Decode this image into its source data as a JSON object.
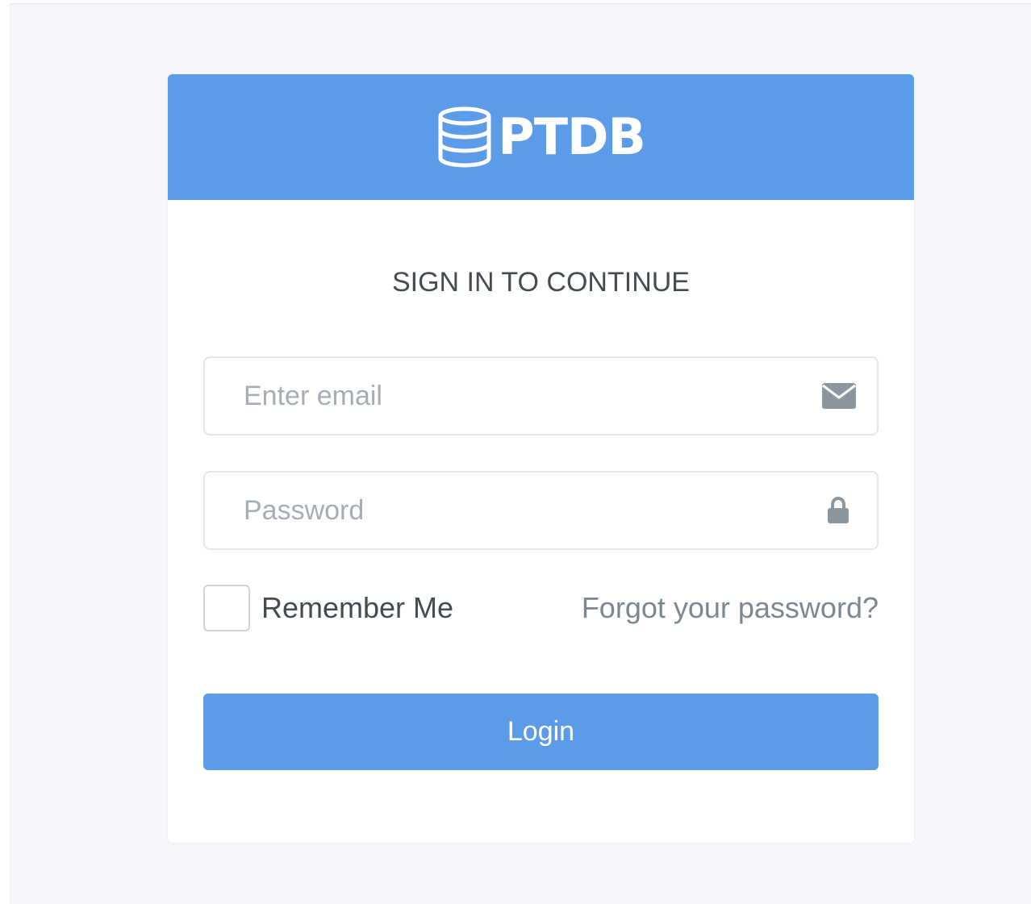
{
  "brand": {
    "name": "PTDB",
    "icon": "database-icon",
    "header_color": "#5b9be8"
  },
  "form": {
    "title": "SIGN IN TO CONTINUE",
    "email": {
      "placeholder": "Enter email",
      "value": "",
      "icon": "envelope-icon"
    },
    "password": {
      "placeholder": "Password",
      "value": "",
      "icon": "lock-icon"
    },
    "remember_label": "Remember Me",
    "remember_checked": false,
    "forgot_label": "Forgot your password?",
    "login_label": "Login"
  },
  "colors": {
    "accent": "#5b9be8",
    "page_background": "#f4f6f9",
    "icon_gray": "#8d969e"
  }
}
